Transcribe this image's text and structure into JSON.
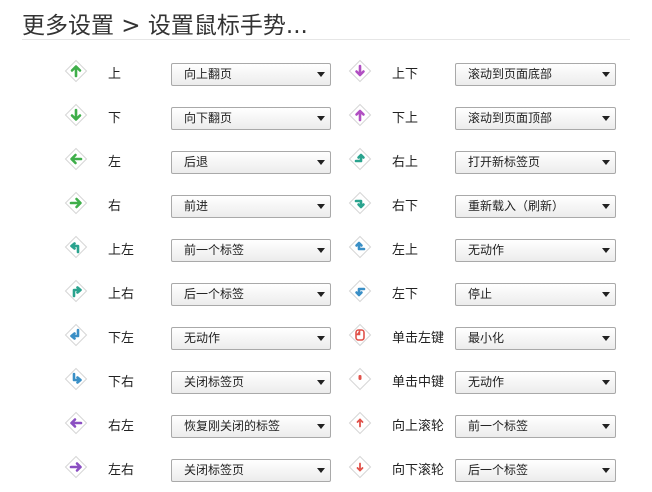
{
  "page": {
    "title": "更多设置 > 设置鼠标手势..."
  },
  "gestures_left": [
    {
      "label": "上",
      "action": "向上翻页",
      "icon": "arrow-up-icon",
      "color": "#3fae4a"
    },
    {
      "label": "下",
      "action": "向下翻页",
      "icon": "arrow-down-icon",
      "color": "#3fae4a"
    },
    {
      "label": "左",
      "action": "后退",
      "icon": "arrow-left-icon",
      "color": "#3fae4a"
    },
    {
      "label": "右",
      "action": "前进",
      "icon": "arrow-right-icon",
      "color": "#3fae4a"
    },
    {
      "label": "上左",
      "action": "前一个标签",
      "icon": "arrow-up-left-icon",
      "color": "#2aa38e"
    },
    {
      "label": "上右",
      "action": "后一个标签",
      "icon": "arrow-up-right-icon",
      "color": "#2aa38e"
    },
    {
      "label": "下左",
      "action": "无动作",
      "icon": "arrow-down-left-icon",
      "color": "#3a8fc6"
    },
    {
      "label": "下右",
      "action": "关闭标签页",
      "icon": "arrow-down-right-icon",
      "color": "#3a8fc6"
    },
    {
      "label": "右左",
      "action": "恢复刚关闭的标签",
      "icon": "arrow-right-left-icon",
      "color": "#8b4fc2"
    },
    {
      "label": "左右",
      "action": "关闭标签页",
      "icon": "arrow-left-right-icon",
      "color": "#8b4fc2"
    }
  ],
  "gestures_right": [
    {
      "label": "上下",
      "action": "滚动到页面底部",
      "icon": "arrow-up-down-icon",
      "color": "#b14fc2"
    },
    {
      "label": "下上",
      "action": "滚动到页面顶部",
      "icon": "arrow-down-up-icon",
      "color": "#b14fc2"
    },
    {
      "label": "右上",
      "action": "打开新标签页",
      "icon": "arrow-right-up-icon",
      "color": "#2aa38e"
    },
    {
      "label": "右下",
      "action": "重新载入（刷新）",
      "icon": "arrow-right-down-icon",
      "color": "#2aa38e"
    },
    {
      "label": "左上",
      "action": "无动作",
      "icon": "arrow-left-up-icon",
      "color": "#3a8fc6"
    },
    {
      "label": "左下",
      "action": "停止",
      "icon": "arrow-left-down-icon",
      "color": "#3a8fc6"
    },
    {
      "label": "单击左键",
      "action": "最小化",
      "icon": "mouse-left-click-icon",
      "color": "#e0524a"
    },
    {
      "label": "单击中键",
      "action": "无动作",
      "icon": "mouse-middle-click-icon",
      "color": "#e0524a"
    },
    {
      "label": "向上滚轮",
      "action": "前一个标签",
      "icon": "wheel-up-icon",
      "color": "#e0524a"
    },
    {
      "label": "向下滚轮",
      "action": "后一个标签",
      "icon": "wheel-down-icon",
      "color": "#e0524a"
    }
  ]
}
